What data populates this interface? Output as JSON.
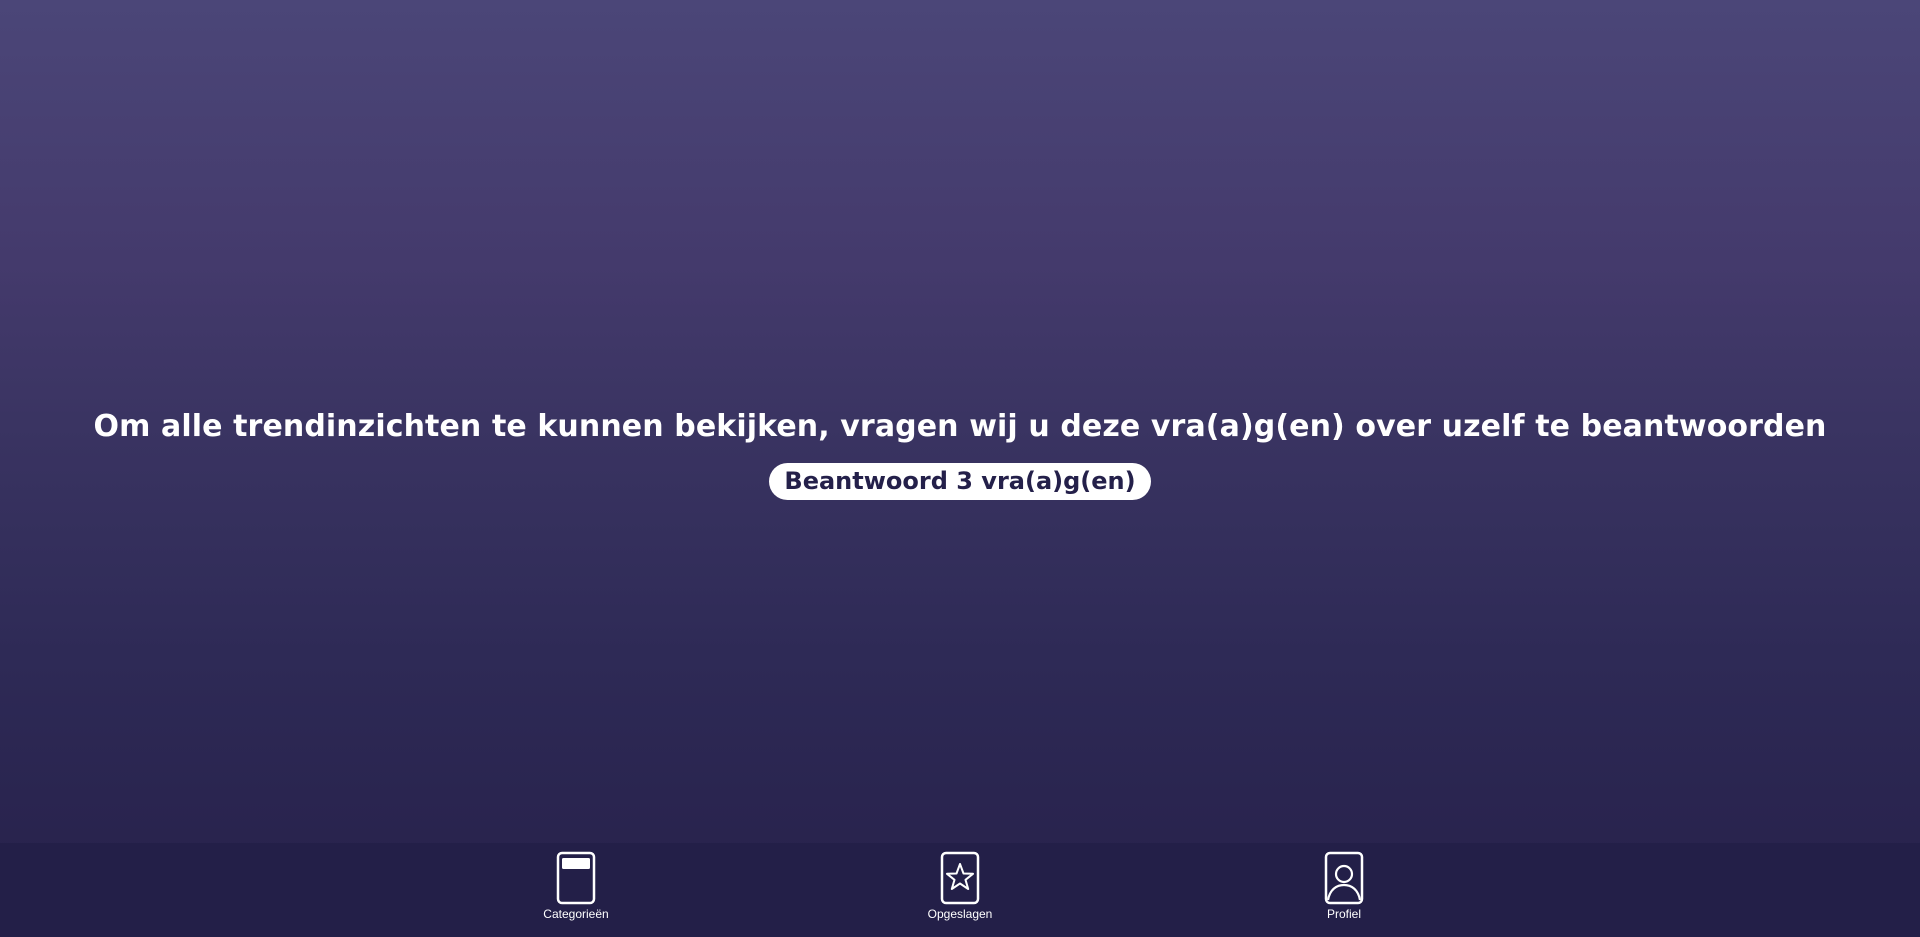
{
  "main": {
    "prompt": "Om alle trendinzichten te kunnen bekijken, vragen wij u deze vra(a)g(en) over uzelf te beantwoorden",
    "cta_label": "Beantwoord 3 vra(a)g(en)"
  },
  "tabbar": {
    "items": [
      {
        "label": "Categorieën",
        "icon": "categories-card-icon"
      },
      {
        "label": "Opgeslagen",
        "icon": "star-icon"
      },
      {
        "label": "Profiel",
        "icon": "person-icon"
      }
    ]
  },
  "colors": {
    "background_top": "#4b4678",
    "background_bottom": "#26204a",
    "button_bg": "#ffffff",
    "button_text": "#24204a",
    "text": "#ffffff"
  }
}
